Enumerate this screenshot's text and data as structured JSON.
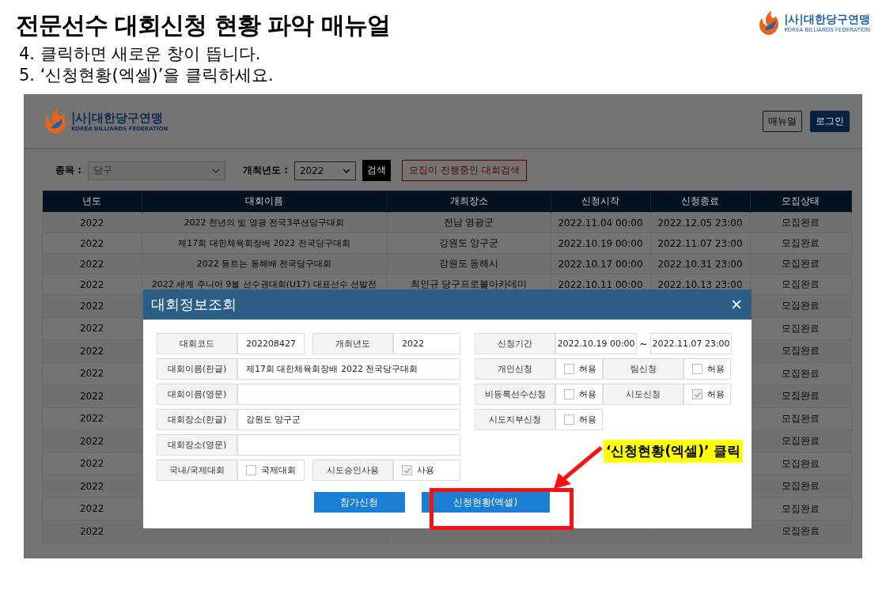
{
  "slide": {
    "title": "전문선수 대회신청 현황 파악 매뉴얼",
    "logo": {
      "name": "|사|대한당구연맹",
      "sub": "KOREA BILLIARDS FEDERATION"
    },
    "steps": [
      "4. 클릭하면 새로운 창이 뜹니다.",
      "5. ‘신청현황(엑셀)’을 클릭하세요."
    ]
  },
  "screen": {
    "logo": {
      "name": "|사|대한당구연맹",
      "sub": "KOREA BILLIARDS FEDERATION"
    },
    "header_buttons": [
      {
        "label": "매뉴얼",
        "kind": "outline"
      },
      {
        "label": "로그인",
        "kind": "primary"
      }
    ],
    "filters": {
      "event": {
        "label": "종목 :",
        "value": "당구",
        "disabled": true
      },
      "year": {
        "label": "개최년도 :",
        "value": "2022"
      },
      "search": "검색",
      "open_search": "모집이 진행중인 대회검색"
    },
    "table": {
      "columns": [
        "년도",
        "대회이름",
        "개최장소",
        "신청시작",
        "신청종료",
        "모집상태"
      ],
      "rows": [
        {
          "year": "2022",
          "name": "2022 천년의 빛 영광 전국3쿠션당구대회",
          "venue": "전남 영광군",
          "start": "2022.11.04 00:00",
          "end": "2022.12.05 23:00",
          "status": "모집완료"
        },
        {
          "year": "2022",
          "name": "제17회 대한체육회장배 2022 전국당구대회",
          "venue": "강원도 양구군",
          "start": "2022.10.19 00:00",
          "end": "2022.11.07 23:00",
          "status": "모집완료"
        },
        {
          "year": "2022",
          "name": "2022 동트는 동해배 전국당구대회",
          "venue": "강원도 동해시",
          "start": "2022.10.17 00:00",
          "end": "2022.10.31 23:00",
          "status": "모집완료"
        },
        {
          "year": "2022",
          "name": "2022 세계 주니어 9볼 선수권대회(U17) 대표선수 선발전",
          "venue": "최인규 당구프로볼아카데미",
          "start": "2022.10.11 00:00",
          "end": "2022.10.13 23:00",
          "status": "모집완료"
        },
        {
          "year": "2022",
          "status": "모집완료"
        },
        {
          "year": "2022",
          "status": "모집완료"
        },
        {
          "year": "2022",
          "status": "모집완료"
        },
        {
          "year": "2022",
          "status": "모집완료"
        },
        {
          "year": "2022",
          "status": "모집완료"
        },
        {
          "year": "2022",
          "status": "모집완료"
        },
        {
          "year": "2022",
          "status": "모집완료"
        },
        {
          "year": "2022",
          "status": "모집완료"
        },
        {
          "year": "2022",
          "status": "모집완료"
        },
        {
          "year": "2022",
          "status": "모집완료"
        },
        {
          "year": "2022",
          "status": "모집완료"
        }
      ]
    },
    "modal": {
      "title": "대회정보조회",
      "close": "×",
      "left_rows": [
        [
          {
            "kind": "label",
            "text": "대회코드"
          },
          {
            "kind": "value",
            "text": "202208427"
          },
          {
            "kind": "label",
            "text": "개최년도"
          },
          {
            "kind": "value",
            "text": "2022"
          }
        ],
        [
          {
            "kind": "label",
            "text": "대회이름(한글)"
          },
          {
            "kind": "wide",
            "text": "제17회 대한체육회장배 2022 전국당구대회"
          }
        ],
        [
          {
            "kind": "label",
            "text": "대회이름(영문)"
          },
          {
            "kind": "wide"
          }
        ],
        [
          {
            "kind": "label",
            "text": "대회장소(한글)"
          },
          {
            "kind": "wide",
            "text": "강원도 양구군"
          }
        ],
        [
          {
            "kind": "label",
            "text": "대회장소(영문)"
          },
          {
            "kind": "wide"
          }
        ],
        [
          {
            "kind": "label",
            "text": "국내/국제대회"
          },
          {
            "kind": "check",
            "text": "국제대회",
            "checked": false
          },
          {
            "kind": "label",
            "text": "시도승인사용"
          },
          {
            "kind": "check",
            "text": "사용",
            "checked": true
          }
        ]
      ],
      "right_rows": [
        [
          {
            "kind": "label",
            "text": "신청기간"
          },
          {
            "kind": "value",
            "text": "2022.10.19 00:00"
          },
          {
            "kind": "sep",
            "text": "~"
          },
          {
            "kind": "value",
            "text": "2022.11.07 23:00"
          }
        ],
        [
          {
            "kind": "label",
            "text": "개인신청"
          },
          {
            "kind": "check",
            "text": "허용",
            "checked": false
          },
          {
            "kind": "label",
            "text": "팀신청"
          },
          {
            "kind": "check",
            "text": "허용",
            "checked": false
          }
        ],
        [
          {
            "kind": "label",
            "text": "비등록선수신청"
          },
          {
            "kind": "check",
            "text": "허용",
            "checked": false
          },
          {
            "kind": "label",
            "text": "시도신청"
          },
          {
            "kind": "check",
            "text": "허용",
            "checked": true
          }
        ],
        [
          {
            "kind": "label",
            "text": "시도지부신청"
          },
          {
            "kind": "check",
            "text": "허용",
            "checked": false
          }
        ]
      ],
      "buttons": [
        {
          "label": "참가신청",
          "annotated": false
        },
        {
          "label": "신청현황(엑셀)",
          "annotated": true
        }
      ]
    }
  },
  "annotation": {
    "callout": "‘신청현황(엑셀)’ 클릭"
  }
}
